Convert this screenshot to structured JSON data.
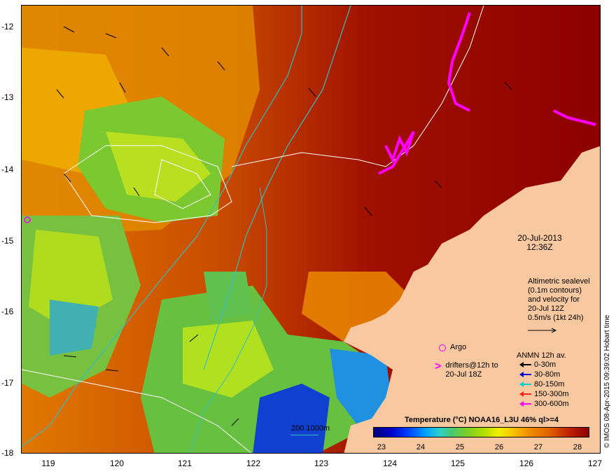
{
  "map": {
    "date_line1": "20-Jul-2013",
    "date_line2": "12:36Z",
    "sealevel_text": [
      "Altimetric sealevel",
      "(0.1m contours)",
      "and velocity for",
      "20-Jul 12Z",
      "0.5m/s (1kt 24h)"
    ],
    "argo_label": "Argo",
    "drifters_label": [
      "drifters@12h to",
      "20-Jul 18Z"
    ],
    "anmn_title": "ANMN 12h av.",
    "anmn_items": [
      {
        "label": "0-30m",
        "color": "#000000"
      },
      {
        "label": "30-80m",
        "color": "#0000cc"
      },
      {
        "label": "80-150m",
        "color": "#00d0d0"
      },
      {
        "label": "150-300m",
        "color": "#ff2020"
      },
      {
        "label": "300-600m",
        "color": "#ff00ff"
      }
    ],
    "scale_label": "200  1000m",
    "colorbar_title": "Temperature (°C) NOAA16_L3U 46% ql>=4",
    "colorbar_ticks": [
      "23",
      "24",
      "25",
      "26",
      "27",
      "28"
    ],
    "credit": "© IMOS 08-Apr-2015 09:39:02 Hobart time",
    "y_ticks": [
      "-12",
      "-13",
      "-14",
      "-15",
      "-16",
      "-17",
      "-18"
    ],
    "x_ticks": [
      "119",
      "120",
      "121",
      "122",
      "123",
      "124",
      "125",
      "126",
      "127"
    ]
  }
}
